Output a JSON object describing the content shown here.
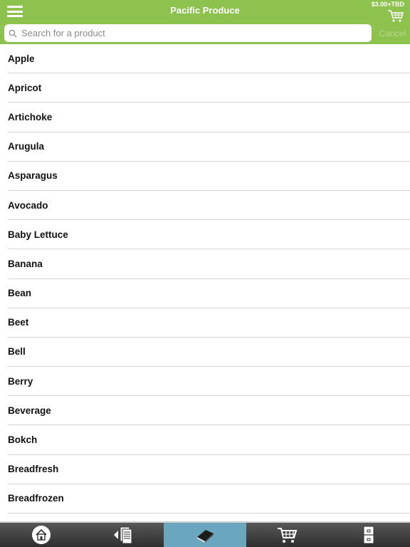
{
  "header": {
    "title": "Pacific Produce",
    "cart_total": "$3.00+TBD",
    "menu_icon": "hamburger-icon",
    "cart_icon": "cart-icon"
  },
  "search": {
    "placeholder": "Search for a product",
    "value": "",
    "cancel_label": "Cancel"
  },
  "products": [
    "Apple",
    "Apricot",
    "Artichoke",
    "Arugula",
    "Asparagus",
    "Avocado",
    "Baby Lettuce",
    "Banana",
    "Bean",
    "Beet",
    "Bell",
    "Berry",
    "Beverage",
    "Bokch",
    "Breadfresh",
    "Breadfrozen"
  ],
  "tabs": [
    {
      "icon": "home-icon",
      "active": false
    },
    {
      "icon": "order-list-icon",
      "active": false
    },
    {
      "icon": "catalog-book-icon",
      "active": true
    },
    {
      "icon": "cart-icon",
      "active": false
    },
    {
      "icon": "cabinet-icon",
      "active": false
    }
  ],
  "colors": {
    "header": "#8dc24e",
    "active_tab": "#6aa7be",
    "tabbar": "#3f3f3f"
  }
}
